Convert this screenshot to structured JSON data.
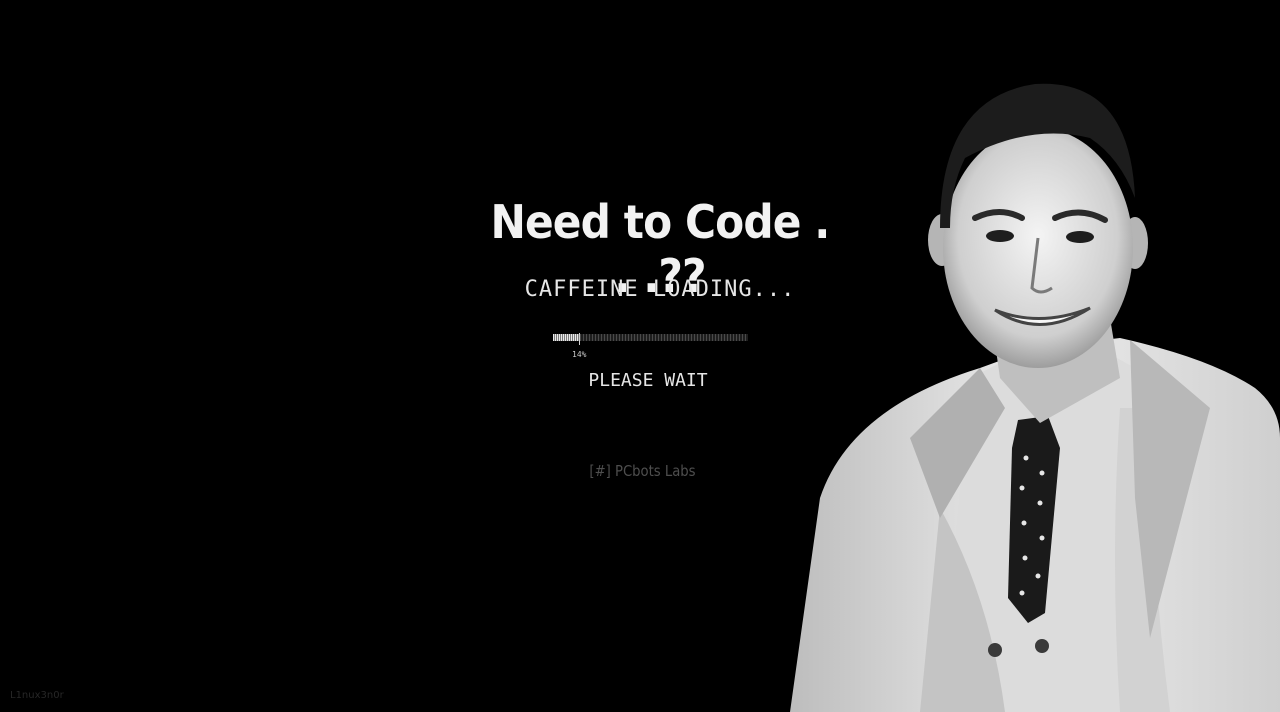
{
  "headline": "Need to Code . . .??",
  "status": "CAFFEINE LOADING...",
  "progress": {
    "percent_label": "14%",
    "value_percent": 14
  },
  "wait_message": "PLEASE WAIT",
  "brand": "[#] PCbots Labs",
  "credit": "L1nux3n0r",
  "colors": {
    "background": "#000000",
    "text": "#f2f2f2",
    "brand_text": "#4e4e4e"
  }
}
